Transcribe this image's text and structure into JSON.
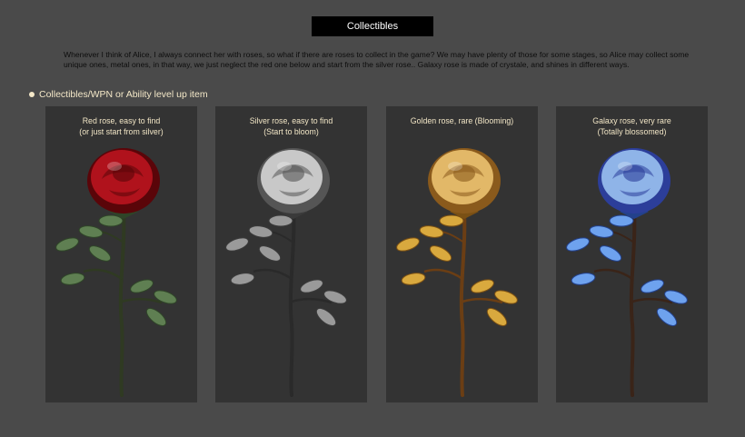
{
  "header": {
    "title": "Collectibles"
  },
  "intro": {
    "text": "Whenever I think of Alice, I always connect her with roses, so what if there are roses to collect in the game? We may have plenty of those for some stages, so Alice may collect some unique ones, metal ones, in that way, we just neglect the red one below and start from the silver rose.. Galaxy rose is made of crystale, and shines in different ways."
  },
  "section": {
    "label": "Collectibles/WPN or Ability level up item"
  },
  "cards": [
    {
      "line1": "Red rose, easy to find",
      "line2": "(or just start from silver)",
      "bloom": "#b0121c",
      "bloom_dark": "#5a0509",
      "stem": "#2f3a22",
      "leaf": "#5f7f52",
      "leaf_dark": "#2f4428"
    },
    {
      "line1": "Silver rose, easy to find",
      "line2": "(Start to bloom)",
      "bloom": "#c8c8c8",
      "bloom_dark": "#555555",
      "stem": "#2a2a2a",
      "leaf": "#9a9a9a",
      "leaf_dark": "#3a3a3a"
    },
    {
      "line1": "Golden rose, rare (Blooming)",
      "line2": "",
      "bloom": "#e2b868",
      "bloom_dark": "#8a5a1c",
      "stem": "#6b3e14",
      "leaf": "#d9a93e",
      "leaf_dark": "#7a5014"
    },
    {
      "line1": "Galaxy rose, very rare",
      "line2": "(Totally blossomed)",
      "bloom": "#8fb4e8",
      "bloom_dark": "#2c3e9a",
      "stem": "#3a2418",
      "leaf": "#6ea2ee",
      "leaf_dark": "#23418c"
    }
  ]
}
